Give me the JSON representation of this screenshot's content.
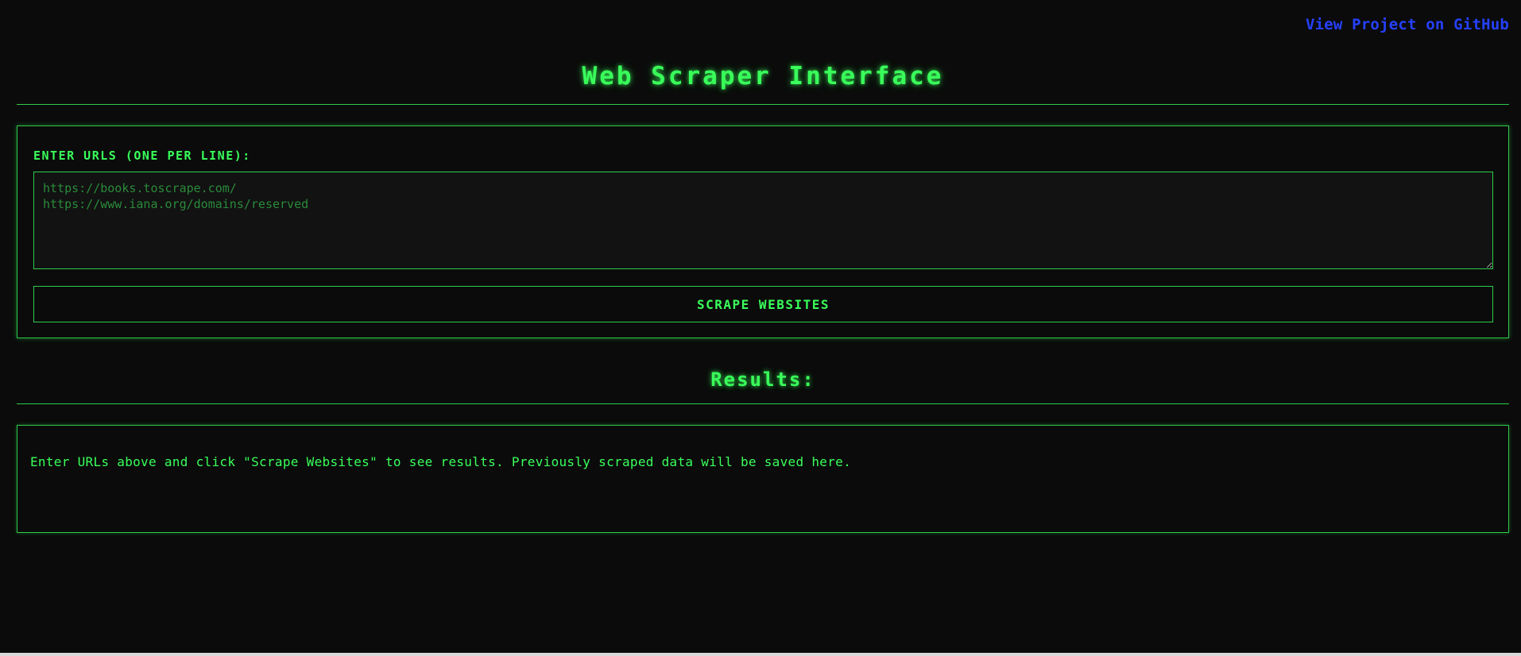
{
  "header": {
    "github_link": "View Project on GitHub",
    "title": "Web Scraper Interface"
  },
  "input_panel": {
    "label": "ENTER URLS (ONE PER LINE):",
    "textarea_value": "",
    "textarea_placeholder": "https://books.toscrape.com/\nhttps://www.iana.org/domains/reserved",
    "button_label": "SCRAPE WEBSITES"
  },
  "results": {
    "title": "Results:",
    "message": "Enter URLs above and click \"Scrape Websites\" to see results. Previously scraped data will be saved here."
  },
  "colors": {
    "background": "#0b0b0b",
    "accent_green": "#39ff5a",
    "border_green": "#2ecc4a",
    "link_blue": "#2541ff",
    "placeholder_green": "#2a8a3a"
  }
}
